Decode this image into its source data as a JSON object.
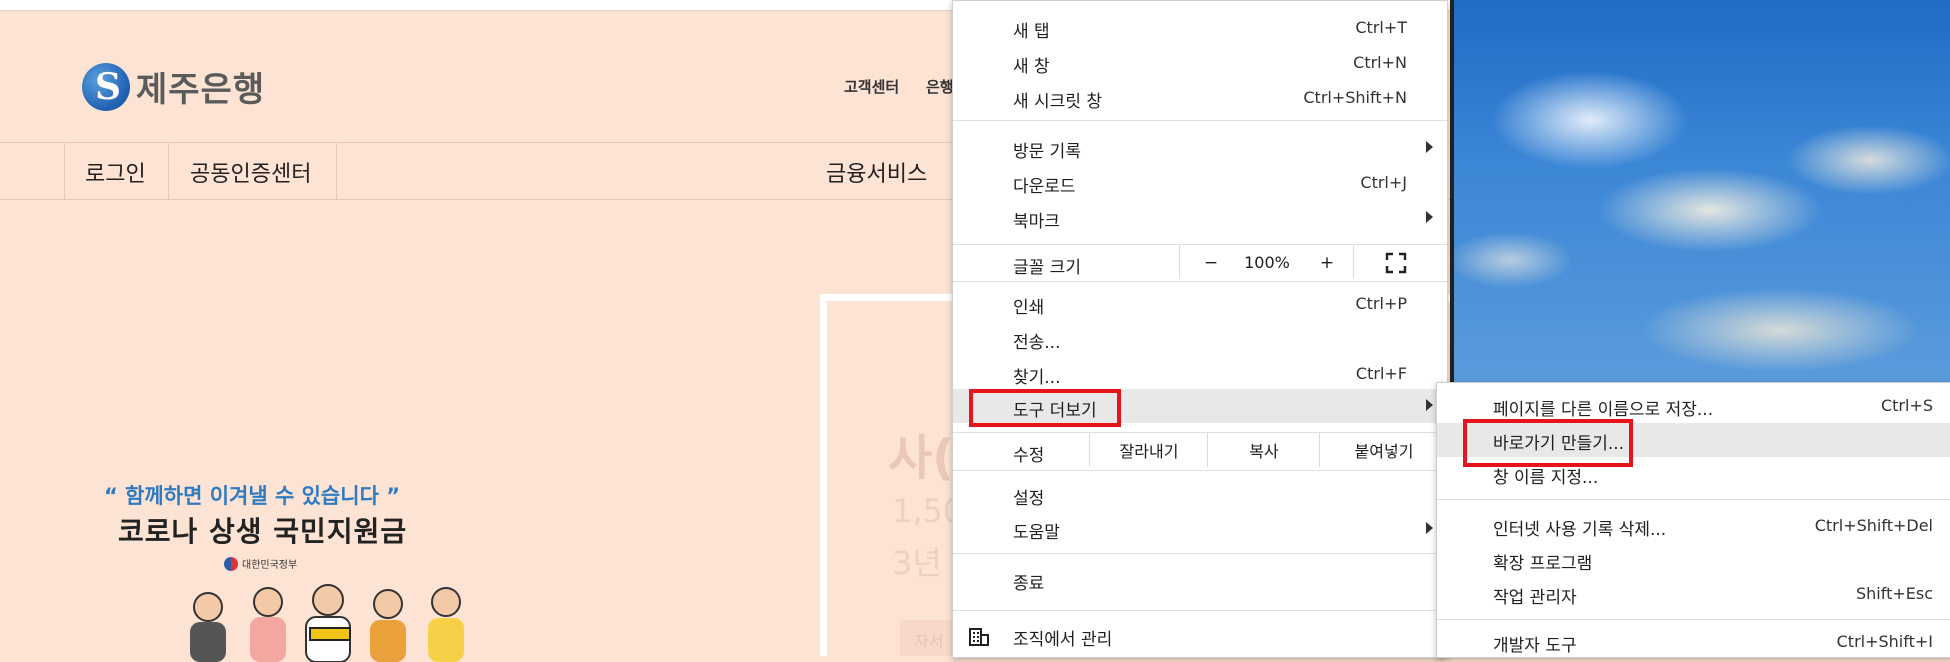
{
  "bank": {
    "logo_text": "제주은행",
    "util_links": [
      "고객센터",
      "은행"
    ],
    "nav": {
      "login": "로그인",
      "cert_center": "공동인증센터",
      "finance": "금융서비스"
    },
    "panel": {
      "title": "사(",
      "line1": "1,50",
      "line2": "3년",
      "button": "자서"
    },
    "promo": {
      "quote": "“ 함께하면 이겨낼 수 있습니다 ”",
      "title": "코로나 상생 국민지원금",
      "gov": "대한민국정부"
    }
  },
  "menu": {
    "new_tab": {
      "label": "새 탭",
      "shortcut": "Ctrl+T"
    },
    "new_window": {
      "label": "새 창",
      "shortcut": "Ctrl+N"
    },
    "incognito": {
      "label": "새 시크릿 창",
      "shortcut": "Ctrl+Shift+N"
    },
    "history": {
      "label": "방문 기록"
    },
    "downloads": {
      "label": "다운로드",
      "shortcut": "Ctrl+J"
    },
    "bookmarks": {
      "label": "북마크"
    },
    "zoom": {
      "label": "글꼴 크기",
      "minus": "−",
      "value": "100%",
      "plus": "+"
    },
    "print": {
      "label": "인쇄",
      "shortcut": "Ctrl+P"
    },
    "cast": {
      "label": "전송..."
    },
    "find": {
      "label": "찾기...",
      "shortcut": "Ctrl+F"
    },
    "more_tools": {
      "label": "도구 더보기"
    },
    "edit": {
      "label": "수정",
      "cut": "잘라내기",
      "copy": "복사",
      "paste": "붙여넣기"
    },
    "settings": {
      "label": "설정"
    },
    "help": {
      "label": "도움말"
    },
    "exit": {
      "label": "종료"
    },
    "managed": {
      "label": "조직에서 관리"
    }
  },
  "submenu": {
    "save_page": {
      "label": "페이지를 다른 이름으로 저장...",
      "shortcut": "Ctrl+S"
    },
    "create_shortcut": {
      "label": "바로가기 만들기..."
    },
    "name_window": {
      "label": "창 이름 지정..."
    },
    "clear_data": {
      "label": "인터넷 사용 기록 삭제...",
      "shortcut": "Ctrl+Shift+Del"
    },
    "extensions": {
      "label": "확장 프로그램"
    },
    "task_manager": {
      "label": "작업 관리자",
      "shortcut": "Shift+Esc"
    },
    "dev_tools": {
      "label": "개발자 도구",
      "shortcut": "Ctrl+Shift+I"
    }
  },
  "colors": {
    "highlight_box": "#e8141b",
    "page_bg": "#fde3d3",
    "logo_blue": "#1f5faf"
  }
}
